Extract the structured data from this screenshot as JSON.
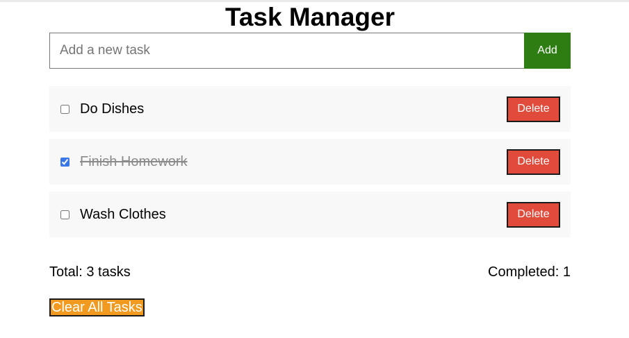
{
  "header": {
    "title": "Task Manager"
  },
  "add_task": {
    "placeholder": "Add a new task",
    "value": "",
    "button_label": "Add"
  },
  "tasks": [
    {
      "text": "Do Dishes",
      "completed": false,
      "delete_label": "Delete"
    },
    {
      "text": "Finish Homework",
      "completed": true,
      "delete_label": "Delete"
    },
    {
      "text": "Wash Clothes",
      "completed": false,
      "delete_label": "Delete"
    }
  ],
  "stats": {
    "total_text": "Total: 3 tasks",
    "completed_text": "Completed: 1"
  },
  "actions": {
    "clear_all_label": "Clear All Tasks"
  },
  "colors": {
    "add_button": "#2e7d12",
    "delete_button": "#e04b3c",
    "clear_button": "#f29a1f",
    "task_background": "#f8f8f8"
  }
}
